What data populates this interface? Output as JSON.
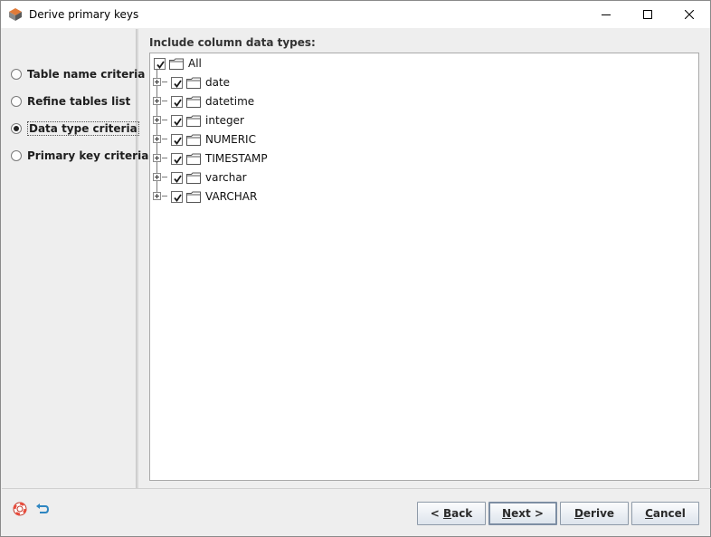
{
  "window": {
    "title": "Derive primary keys"
  },
  "nav": {
    "items": [
      {
        "label": "Table name criteria",
        "selected": false
      },
      {
        "label": "Refine tables list",
        "selected": false
      },
      {
        "label": "Data type criteria",
        "selected": true
      },
      {
        "label": "Primary key criteria",
        "selected": false
      }
    ]
  },
  "content": {
    "section_label": "Include column data types:",
    "tree": {
      "root": {
        "label": "All",
        "checked": true,
        "icon": "folder-icon"
      },
      "children": [
        {
          "label": "date",
          "checked": true
        },
        {
          "label": "datetime",
          "checked": true
        },
        {
          "label": "integer",
          "checked": true
        },
        {
          "label": "NUMERIC",
          "checked": true
        },
        {
          "label": "TIMESTAMP",
          "checked": true
        },
        {
          "label": "varchar",
          "checked": true
        },
        {
          "label": "VARCHAR",
          "checked": true
        }
      ]
    }
  },
  "buttons": {
    "back": {
      "mnemonic": "B",
      "prefix": "< ",
      "rest": "ack"
    },
    "next": {
      "mnemonic": "N",
      "prefix": "",
      "rest": "ext >"
    },
    "derive": {
      "mnemonic": "D",
      "prefix": "",
      "rest": "erive"
    },
    "cancel": {
      "mnemonic": "C",
      "prefix": "",
      "rest": "ancel"
    }
  },
  "icons": {
    "help": "lifebuoy-icon",
    "undo": "undo-arrow-icon"
  },
  "colors": {
    "window_bg": "#eeeeee",
    "tree_bg": "#ffffff",
    "button_border": "#8e9aa8"
  }
}
